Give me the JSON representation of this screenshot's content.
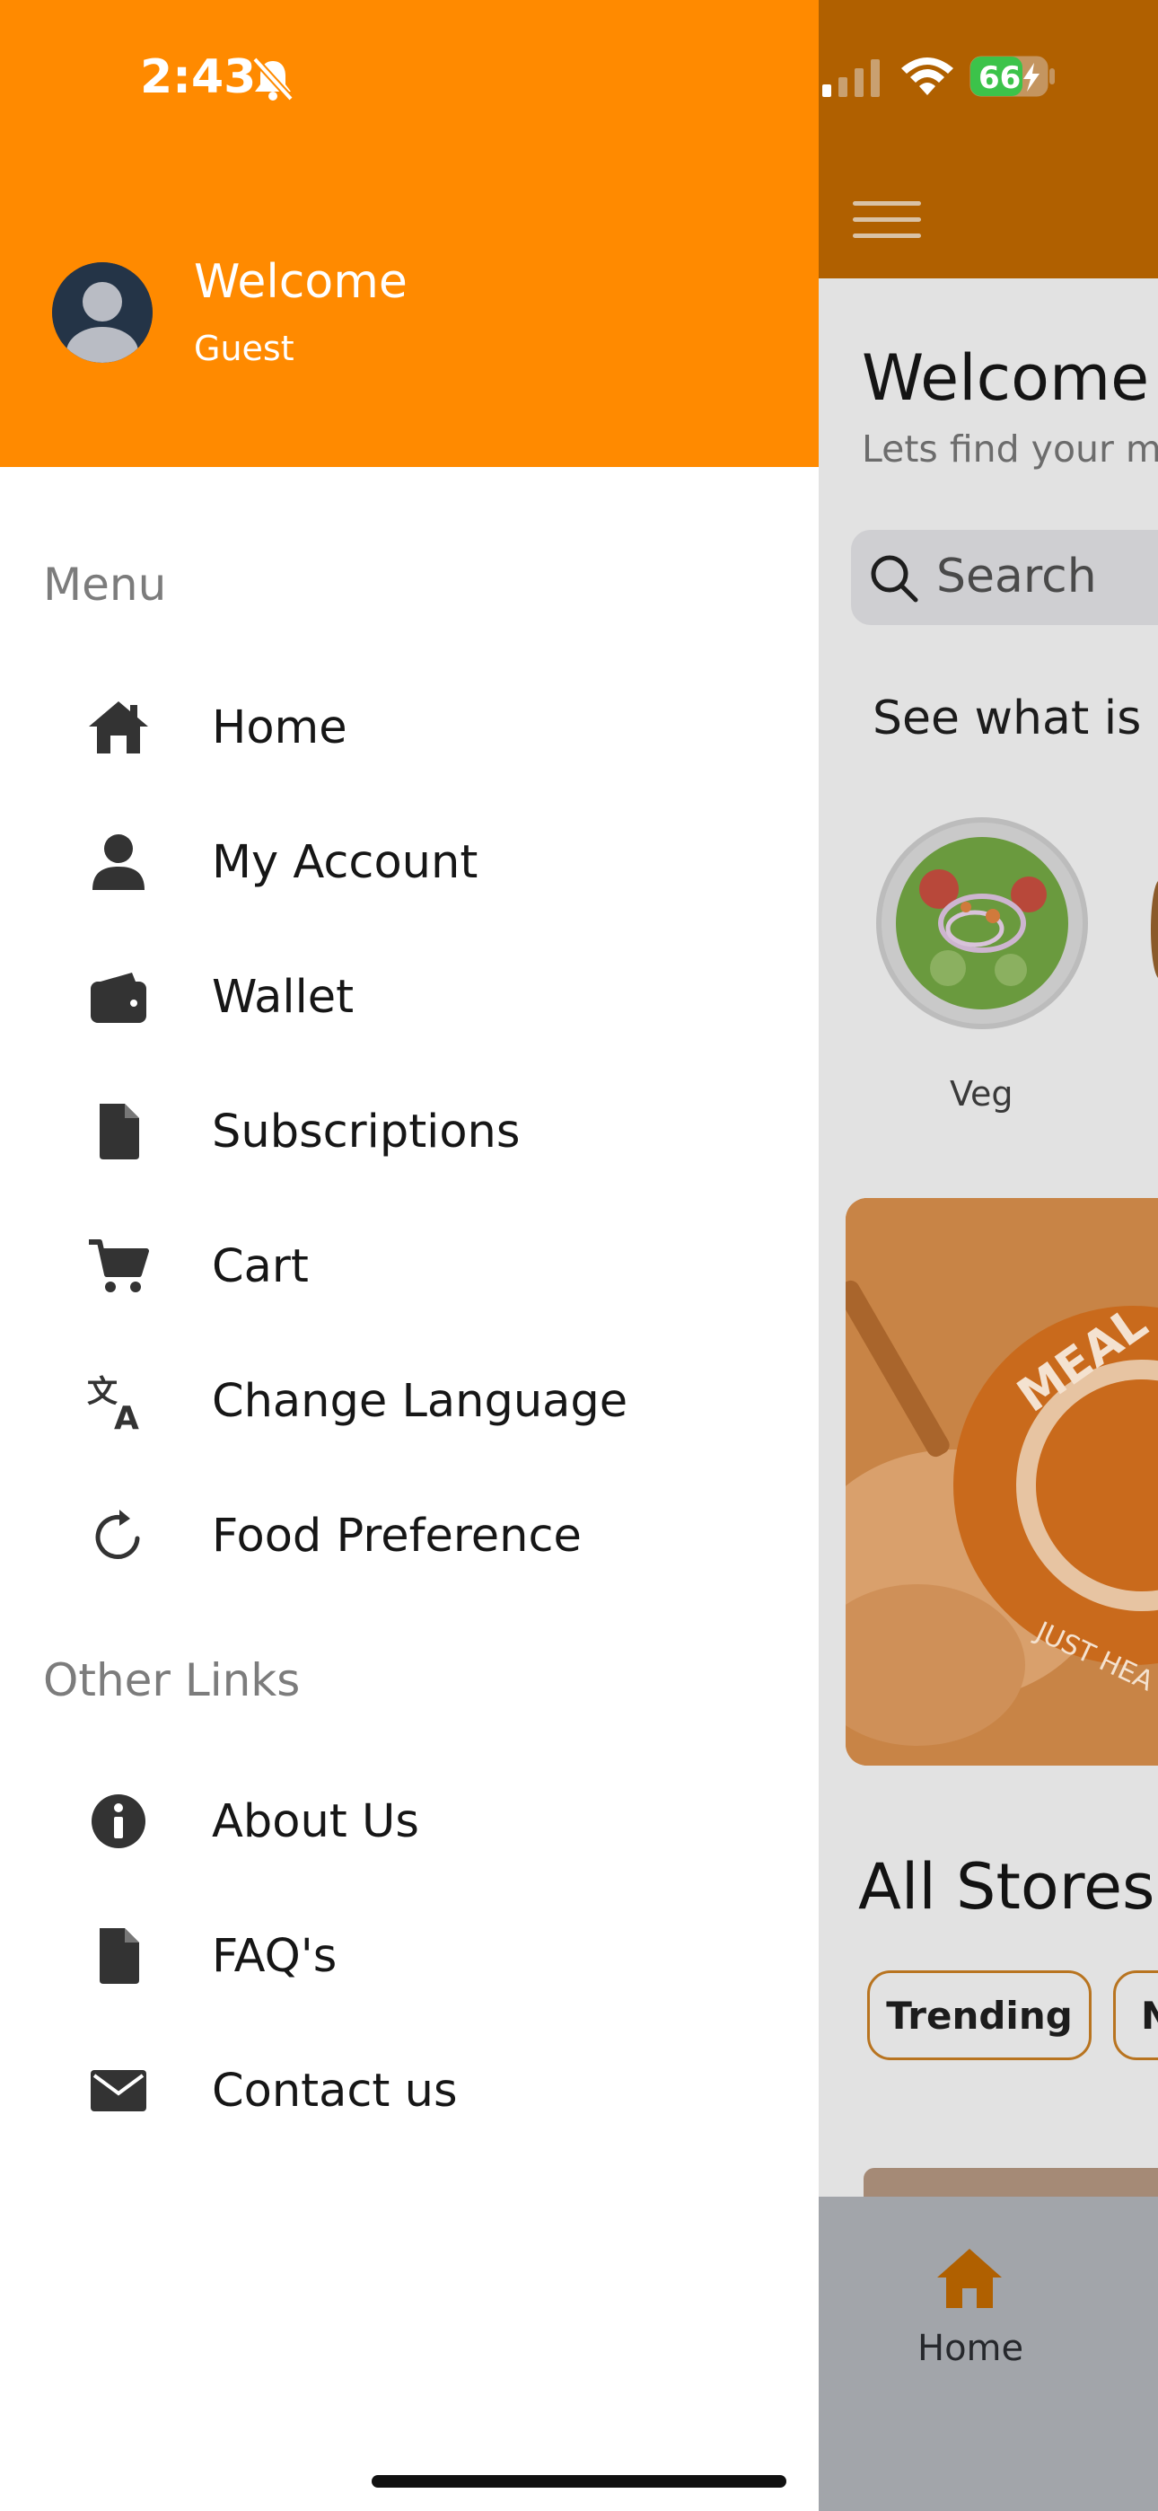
{
  "status_bar": {
    "time": "2:43",
    "battery": "66"
  },
  "background_app": {
    "title": "Welcome",
    "subtitle": "Lets find your m",
    "search_placeholder": "Search",
    "section_heading": "See what is c",
    "category_label": "Veg",
    "stores_heading": "All Stores",
    "chips": [
      "Trending",
      "N"
    ],
    "tab_home_label": "Home",
    "colors": {
      "header": "#b06000",
      "tab_active": "#b06000"
    }
  },
  "drawer": {
    "welcome": "Welcome",
    "user": "Guest",
    "menu_label": "Menu",
    "menu_items": [
      {
        "label": "Home",
        "icon": "home-icon"
      },
      {
        "label": "My Account",
        "icon": "user-icon"
      },
      {
        "label": "Wallet",
        "icon": "wallet-icon"
      },
      {
        "label": "Subscriptions",
        "icon": "document-icon"
      },
      {
        "label": "Cart",
        "icon": "cart-icon"
      },
      {
        "label": "Change Language",
        "icon": "translate-icon"
      },
      {
        "label": "Food Preference",
        "icon": "refresh-icon"
      }
    ],
    "other_label": "Other Links",
    "other_items": [
      {
        "label": "About Us",
        "icon": "info-icon"
      },
      {
        "label": "FAQ's",
        "icon": "document-icon"
      },
      {
        "label": "Contact us",
        "icon": "mail-icon"
      }
    ],
    "colors": {
      "header": "#ff8a00",
      "icon": "#333333"
    }
  }
}
